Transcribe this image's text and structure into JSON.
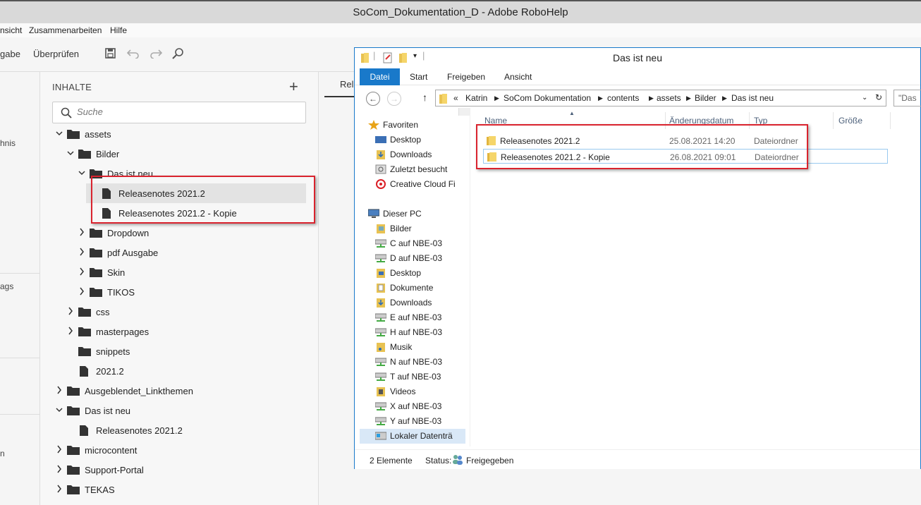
{
  "robohelp": {
    "window_title": "SoCom_Dokumentation_D - Adobe RoboHelp",
    "menu": [
      "nsicht",
      "Zusammenarbeiten",
      "Hilfe"
    ],
    "toolbar": {
      "ausgabe_label": "gabe",
      "pruefen_label": "Überprüfen"
    },
    "left_rail": [
      "hnis",
      "ags",
      "n"
    ],
    "panel": {
      "title": "INHALTE",
      "search_placeholder": "Suche",
      "tree": [
        {
          "label": "assets",
          "type": "folder",
          "expanded": true
        },
        {
          "label": "Bilder",
          "type": "folder",
          "expanded": true
        },
        {
          "label": "Das ist neu",
          "type": "folder",
          "expanded": true
        },
        {
          "label": "Releasenotes 2021.2",
          "type": "file",
          "selected": true
        },
        {
          "label": "Releasenotes 2021.2 - Kopie",
          "type": "file"
        },
        {
          "label": "Dropdown",
          "type": "folder",
          "expanded": false
        },
        {
          "label": "pdf Ausgabe",
          "type": "folder",
          "expanded": false
        },
        {
          "label": "Skin",
          "type": "folder",
          "expanded": false
        },
        {
          "label": "TIKOS",
          "type": "folder",
          "expanded": false
        },
        {
          "label": "css",
          "type": "folder",
          "expanded": false
        },
        {
          "label": "masterpages",
          "type": "folder",
          "expanded": false
        },
        {
          "label": "snippets",
          "type": "folder"
        },
        {
          "label": "2021.2",
          "type": "file"
        },
        {
          "label": "Ausgeblendet_Linkthemen",
          "type": "folder",
          "expanded": false
        },
        {
          "label": "Das ist neu",
          "type": "folder",
          "expanded": true
        },
        {
          "label": "Releasenotes 2021.2",
          "type": "file"
        },
        {
          "label": "microcontent",
          "type": "folder",
          "expanded": false
        },
        {
          "label": "Support-Portal",
          "type": "folder",
          "expanded": false
        },
        {
          "label": "TEKAS",
          "type": "folder",
          "expanded": false
        }
      ]
    },
    "doc_tab": "Rele"
  },
  "explorer": {
    "window_title": "Das ist neu",
    "tabs": [
      "Datei",
      "Start",
      "Freigeben",
      "Ansicht"
    ],
    "address": [
      "«",
      "Katrin",
      "SoCom Dokumentation",
      "contents",
      "assets",
      "Bilder",
      "Das ist neu"
    ],
    "search_placeholder": "\"Das",
    "nav": [
      {
        "label": "Favoriten",
        "icon": "star-icon",
        "level": 0
      },
      {
        "label": "Desktop",
        "icon": "desktop-icon",
        "level": 1
      },
      {
        "label": "Downloads",
        "icon": "downloads-folder-icon",
        "level": 1
      },
      {
        "label": "Zuletzt besucht",
        "icon": "recent-icon",
        "level": 1
      },
      {
        "label": "Creative Cloud Fi",
        "icon": "creative-cloud-icon",
        "level": 1
      },
      {
        "label": "",
        "icon": "",
        "level": -1
      },
      {
        "label": "Dieser PC",
        "icon": "computer-icon",
        "level": 0
      },
      {
        "label": "Bilder",
        "icon": "pictures-folder-icon",
        "level": 1
      },
      {
        "label": "C auf NBE-03",
        "icon": "network-drive-icon",
        "level": 1
      },
      {
        "label": "D auf NBE-03",
        "icon": "network-drive-icon",
        "level": 1
      },
      {
        "label": "Desktop",
        "icon": "desktop-folder-icon",
        "level": 1
      },
      {
        "label": "Dokumente",
        "icon": "documents-folder-icon",
        "level": 1
      },
      {
        "label": "Downloads",
        "icon": "downloads-folder-icon",
        "level": 1
      },
      {
        "label": "E auf NBE-03",
        "icon": "network-drive-icon",
        "level": 1
      },
      {
        "label": "H auf NBE-03",
        "icon": "network-drive-icon",
        "level": 1
      },
      {
        "label": "Musik",
        "icon": "music-folder-icon",
        "level": 1
      },
      {
        "label": "N auf NBE-03",
        "icon": "network-drive-icon",
        "level": 1
      },
      {
        "label": "T auf NBE-03",
        "icon": "network-drive-icon",
        "level": 1
      },
      {
        "label": "Videos",
        "icon": "videos-folder-icon",
        "level": 1
      },
      {
        "label": "X auf NBE-03",
        "icon": "network-drive-icon",
        "level": 1
      },
      {
        "label": "Y auf NBE-03",
        "icon": "network-drive-icon",
        "level": 1
      },
      {
        "label": "Lokaler Datenträ",
        "icon": "local-drive-icon",
        "level": 1,
        "selected": true
      }
    ],
    "columns": [
      "Name",
      "Änderungsdatum",
      "Typ",
      "Größe"
    ],
    "files": [
      {
        "name": "Releasenotes 2021.2",
        "date": "25.08.2021 14:20",
        "type": "Dateiordner"
      },
      {
        "name": "Releasenotes 2021.2 - Kopie",
        "date": "26.08.2021 09:01",
        "type": "Dateiordner",
        "selected": true
      }
    ],
    "status": {
      "count": "2 Elemente",
      "status_label": "Status:",
      "status_value": "Freigegeben"
    }
  },
  "colors": {
    "accent": "#1979ca",
    "highlight": "#d9232e"
  }
}
